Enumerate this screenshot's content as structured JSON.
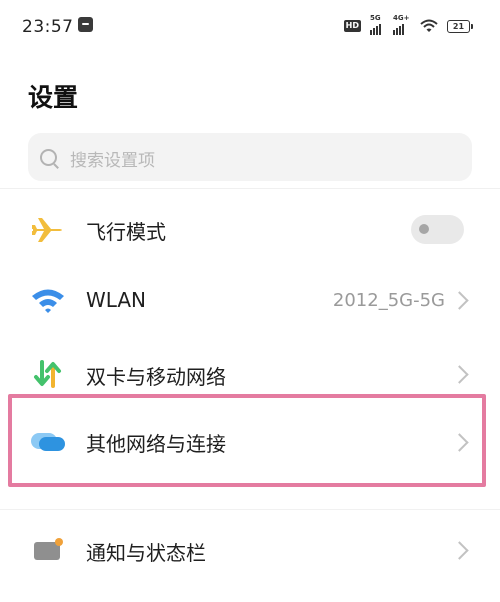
{
  "status_bar": {
    "time": "23:57",
    "sim_badge": "HD",
    "sim1_network": "5G",
    "sim2_network": "4G+",
    "battery_level": "21"
  },
  "page": {
    "title": "设置"
  },
  "search": {
    "placeholder": "搜索设置项"
  },
  "items": [
    {
      "label": "飞行模式",
      "icon": "airplane-icon",
      "control": "toggle",
      "toggle_on": false
    },
    {
      "label": "WLAN",
      "icon": "wifi-icon",
      "value": "2012_5G-5G",
      "control": "chevron"
    },
    {
      "label": "双卡与移动网络",
      "icon": "dual-sim-icon",
      "control": "chevron"
    },
    {
      "label": "其他网络与连接",
      "icon": "cloud-connection-icon",
      "control": "chevron",
      "highlighted": true
    },
    {
      "label": "通知与状态栏",
      "icon": "notification-icon",
      "control": "chevron"
    }
  ],
  "colors": {
    "airplane": "#f2bd3c",
    "wifi": "#3b8ee8",
    "dual_sim_left": "#44c26c",
    "dual_sim_right": "#f2b42f",
    "cloud": "#2e93e0",
    "notification": "#8f8f8f",
    "highlight_border": "#e47ba0"
  }
}
